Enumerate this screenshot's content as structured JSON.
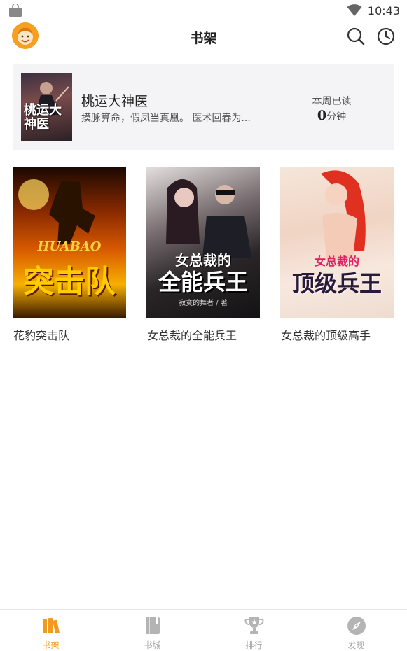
{
  "status_bar": {
    "time": "10:43"
  },
  "header": {
    "title": "书架"
  },
  "reading_card": {
    "book_title": "桃运大神医",
    "description": "摸脉算命，假凤当真凰。 医术回春为...",
    "cover_text": "桃运大神医",
    "read_label": "本周已读",
    "read_minutes": "0",
    "read_unit": "分钟"
  },
  "books": [
    {
      "title": "花豹突击队",
      "cover_text": "突击队",
      "cover_subtext": "HUABAO"
    },
    {
      "title": "女总裁的全能兵王",
      "cover_text": "全能兵王",
      "cover_subtext": "女总裁的",
      "cover_author": "寂寞的舞者 / 著"
    },
    {
      "title": "女总裁的顶级高手",
      "cover_text": "顶级兵王",
      "cover_subtext": "女总裁的"
    }
  ],
  "bottom_nav": {
    "items": [
      {
        "label": "书架",
        "icon": "bookshelf-icon",
        "active": true
      },
      {
        "label": "书城",
        "icon": "book-store-icon",
        "active": false
      },
      {
        "label": "排行",
        "icon": "trophy-icon",
        "active": false
      },
      {
        "label": "发现",
        "icon": "compass-icon",
        "active": false
      }
    ]
  },
  "colors": {
    "accent": "#f29a1d",
    "inactive": "#a8a8a8",
    "card_bg": "#f4f4f6"
  }
}
